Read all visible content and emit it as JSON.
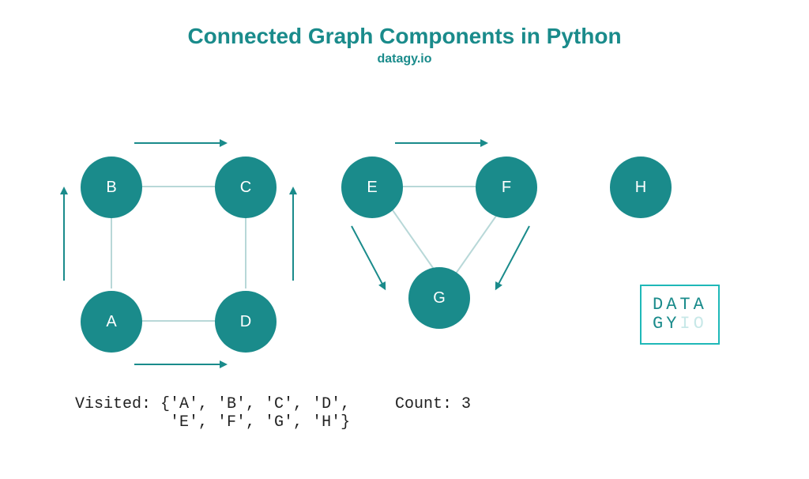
{
  "title": "Connected Graph Components in Python",
  "subtitle": "datagy.io",
  "nodes": {
    "A": "A",
    "B": "B",
    "C": "C",
    "D": "D",
    "E": "E",
    "F": "F",
    "G": "G",
    "H": "H"
  },
  "status": {
    "visited_label": "Visited:",
    "visited_set_line1": "{'A', 'B', 'C', 'D',",
    "visited_set_line2": " 'E', 'F', 'G', 'H'}",
    "count_label": "Count:",
    "count_value": "3"
  },
  "logo": {
    "line1": "DATA",
    "line2a": "GY",
    "line2b": "IO"
  },
  "chart_data": {
    "type": "graph",
    "components": [
      {
        "nodes": [
          "A",
          "B",
          "C",
          "D"
        ],
        "edges": [
          [
            "A",
            "B"
          ],
          [
            "B",
            "C"
          ],
          [
            "C",
            "D"
          ],
          [
            "A",
            "D"
          ]
        ]
      },
      {
        "nodes": [
          "E",
          "F",
          "G"
        ],
        "edges": [
          [
            "E",
            "F"
          ],
          [
            "E",
            "G"
          ],
          [
            "F",
            "G"
          ]
        ]
      },
      {
        "nodes": [
          "H"
        ],
        "edges": []
      }
    ],
    "visited": [
      "A",
      "B",
      "C",
      "D",
      "E",
      "F",
      "G",
      "H"
    ],
    "component_count": 3
  },
  "colors": {
    "accent": "#1a8b8b",
    "node_fill": "#1a8b8b",
    "edge": "#b8d8d8",
    "logo_border": "#1fb8b8"
  }
}
